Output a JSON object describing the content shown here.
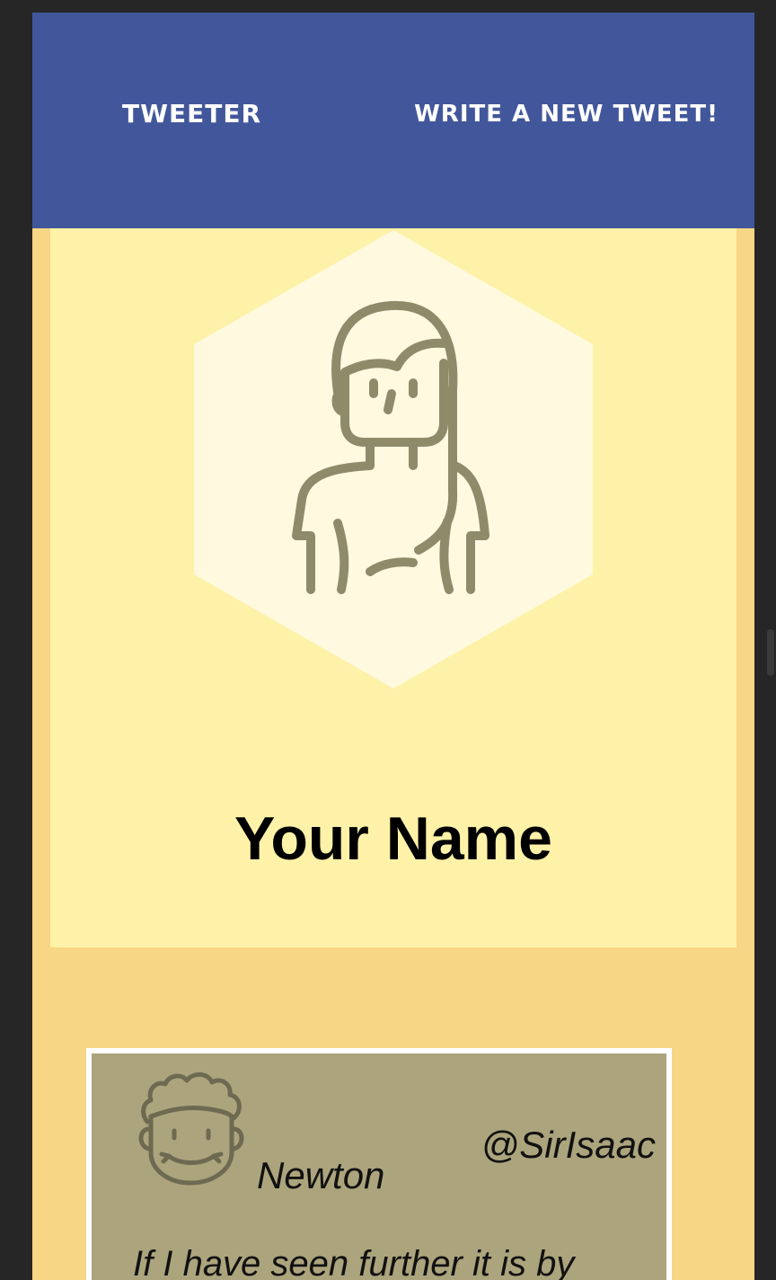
{
  "navbar": {
    "brand_label": "TWEETER",
    "write_label": "WRITE A NEW TWEET!",
    "background": "#42579b"
  },
  "profile": {
    "name": "Your Name",
    "avatar_icon": "woman-avatar-icon",
    "card_color": "#fef2a8"
  },
  "tweets": [
    {
      "name": "Newton",
      "handle": "@SirIsaac",
      "text": "If I have seen further it is by",
      "avatar_icon": "man-avatar-icon"
    }
  ],
  "colors": {
    "page_background": "#f7d685",
    "tweet_background": "#aca47c"
  }
}
